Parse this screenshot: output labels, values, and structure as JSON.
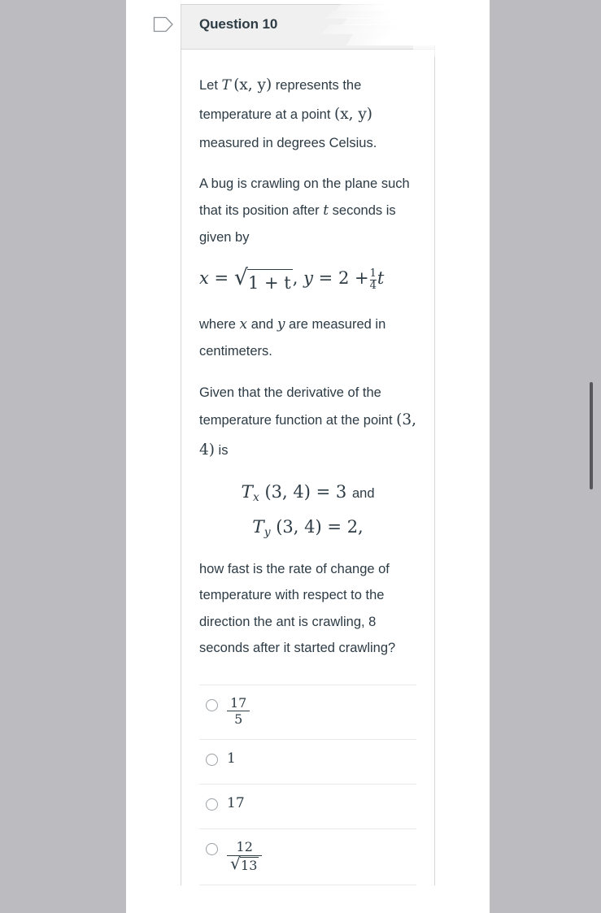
{
  "header": {
    "title": "Question 10",
    "tag_icon": "tag-outline-icon"
  },
  "question": {
    "paragraph_1": {
      "lead": "Let ",
      "math_T": "T",
      "math_xy_1": "(x, y)",
      "mid_1": " represents the temperature at a point ",
      "math_xy_2": "(x, y)",
      "tail_1": " measured in degrees Celsius."
    },
    "paragraph_2": {
      "lead": "A bug is crawling on the plane such that its position after ",
      "math_t": "t",
      "tail": " seconds is given by"
    },
    "display_position": {
      "x_label": "x",
      "equals": "=",
      "sqrt_body": "1 + t",
      "comma": ",",
      "y_label": "y",
      "equals_2": "=",
      "two": "2",
      "plus": "+",
      "frac_num": "1",
      "frac_den": "4",
      "t_label": "t"
    },
    "paragraph_3": {
      "lead": "where ",
      "math_x": "x",
      "mid": " and ",
      "math_y": "y",
      "tail": " are measured in centimeters."
    },
    "paragraph_4": {
      "lead": "Given that the derivative of the temperature function at the point ",
      "math_point": "(3, 4)",
      "tail": " is"
    },
    "display_derivatives": {
      "line_1_T": "T",
      "line_1_sub": "x",
      "line_1_point": "(3, 4)",
      "line_1_equals": "=",
      "line_1_value": "3",
      "line_1_and": "and",
      "line_2_T": "T",
      "line_2_sub": "y",
      "line_2_point": "(3, 4)",
      "line_2_equals": "=",
      "line_2_value": "2,"
    },
    "paragraph_5": "how fast is the rate of change of temperature with respect to the direction the ant is crawling, 8 seconds after it started crawling?"
  },
  "answers": [
    {
      "id": "option-a",
      "type": "fraction",
      "numerator": "17",
      "denominator": "5",
      "selected": false
    },
    {
      "id": "option-b",
      "type": "plain",
      "value": "1",
      "selected": false
    },
    {
      "id": "option-c",
      "type": "plain",
      "value": "17",
      "selected": false
    },
    {
      "id": "option-d",
      "type": "fraction-sqrt",
      "numerator": "12",
      "denominator": "13",
      "selected": false
    }
  ],
  "scrollbar": {
    "orientation": "vertical"
  },
  "colors": {
    "page_background": "#bcbcc0",
    "card_background": "#ffffff",
    "header_background": "#f0f0f0",
    "text": "#2d3b45",
    "border": "#d4d6d8",
    "separator": "#e8e9ea",
    "scrollbar_thumb": "#58585c"
  }
}
